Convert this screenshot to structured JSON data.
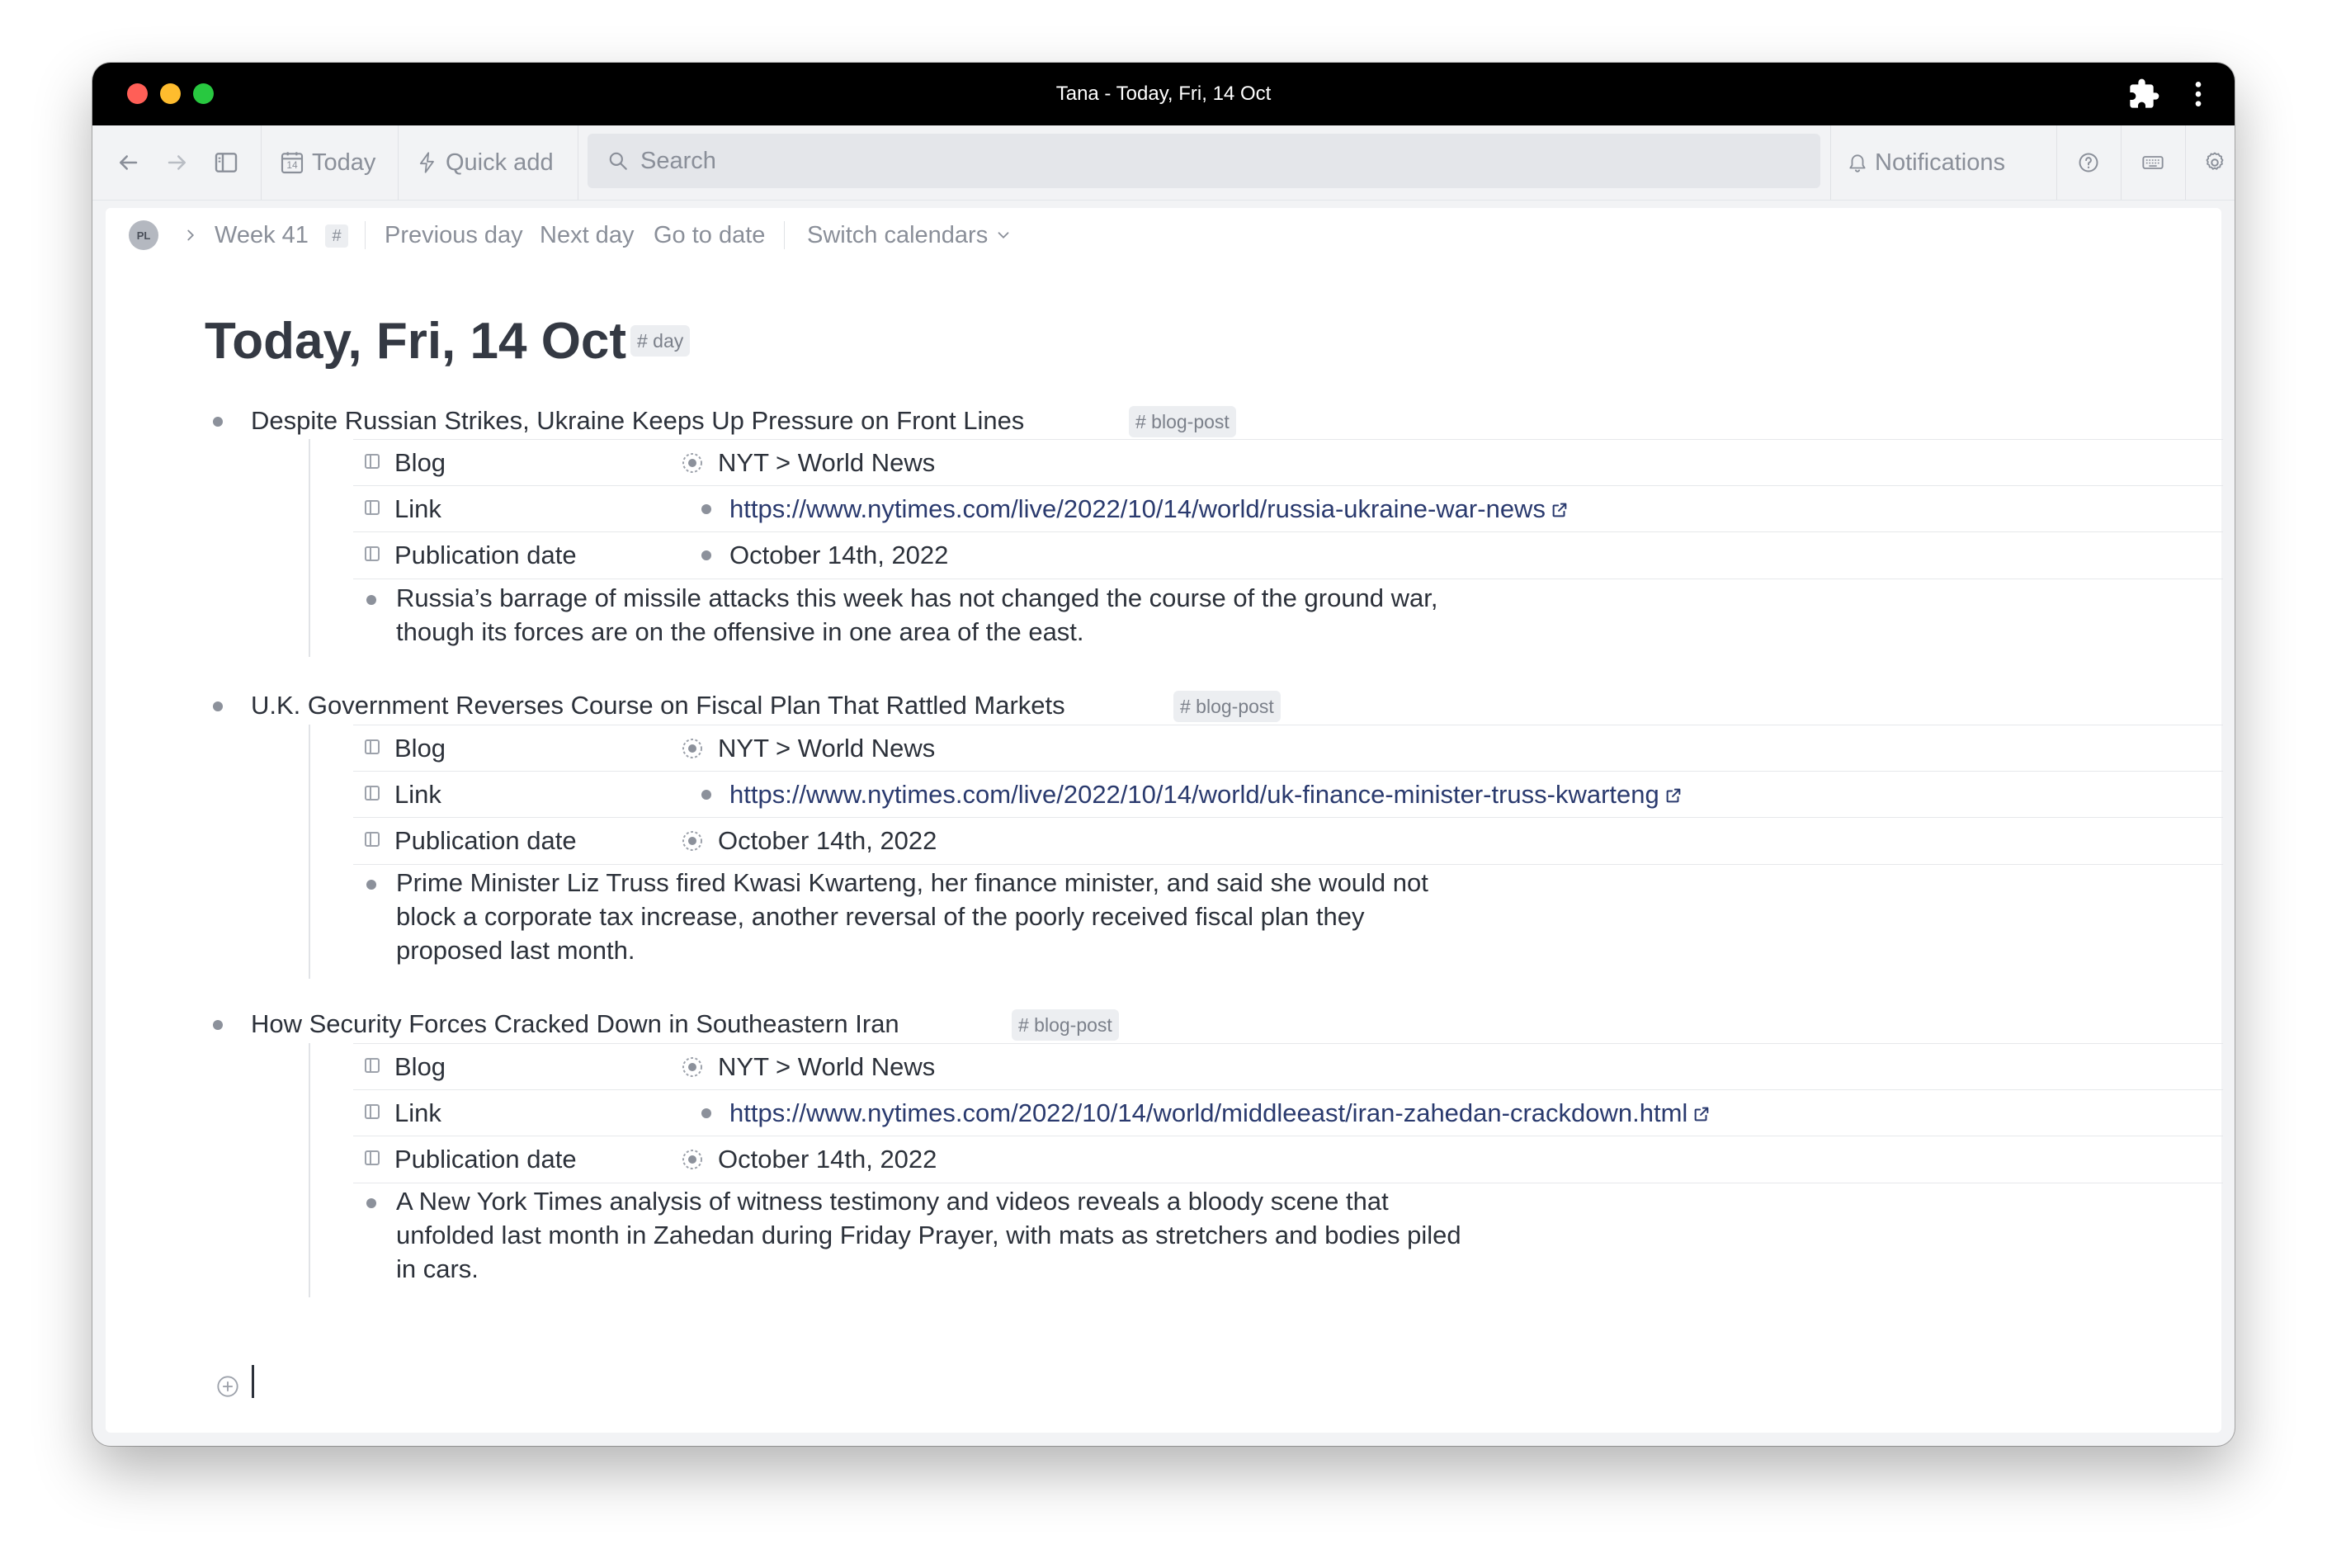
{
  "window": {
    "title": "Tana - Today, Fri, 14 Oct"
  },
  "toolbar": {
    "today_label": "Today",
    "today_icon_day": "14",
    "quick_add_label": "Quick add",
    "search_placeholder": "Search",
    "notifications_label": "Notifications"
  },
  "breadcrumb": {
    "avatar_initials": "PL",
    "week_label": "Week 41",
    "hash": "#",
    "previous_day": "Previous day",
    "next_day": "Next day",
    "go_to_date": "Go to date",
    "switch_calendars": "Switch calendars"
  },
  "page": {
    "title": "Today, Fri, 14 Oct",
    "tag": "# day"
  },
  "posts": [
    {
      "title": "Despite Russian Strikes, Ukraine Keeps Up Pressure on Front Lines",
      "tag": "# blog-post",
      "fields": [
        {
          "label": "Blog",
          "value": "NYT > World News",
          "kind": "reference"
        },
        {
          "label": "Link",
          "value": "https://www.nytimes.com/live/2022/10/14/world/russia-ukraine-war-news",
          "kind": "link"
        },
        {
          "label": "Publication date",
          "value": "October 14th, 2022",
          "kind": "plain"
        }
      ],
      "description_lines": [
        "Russia’s barrage of missile attacks this week has not changed the course of the ground war,",
        "though its forces are on the offensive in one area of the east."
      ]
    },
    {
      "title": "U.K. Government Reverses Course on Fiscal Plan That Rattled Markets",
      "tag": "# blog-post",
      "fields": [
        {
          "label": "Blog",
          "value": "NYT > World News",
          "kind": "reference"
        },
        {
          "label": "Link",
          "value": "https://www.nytimes.com/live/2022/10/14/world/uk-finance-minister-truss-kwarteng",
          "kind": "link"
        },
        {
          "label": "Publication date",
          "value": "October 14th, 2022",
          "kind": "reference"
        }
      ],
      "description_lines": [
        "Prime Minister Liz Truss fired Kwasi Kwarteng, her finance minister, and said she would not",
        "block a corporate tax increase, another reversal of the poorly received fiscal plan they",
        "proposed last month."
      ]
    },
    {
      "title": "How Security Forces Cracked Down in Southeastern Iran",
      "tag": "# blog-post",
      "fields": [
        {
          "label": "Blog",
          "value": "NYT > World News",
          "kind": "reference"
        },
        {
          "label": "Link",
          "value": "https://www.nytimes.com/2022/10/14/world/middleeast/iran-zahedan-crackdown.html",
          "kind": "link"
        },
        {
          "label": "Publication date",
          "value": "October 14th, 2022",
          "kind": "reference"
        }
      ],
      "description_lines": [
        "A New York Times analysis of witness testimony and videos reveals a bloody scene that",
        "unfolded last month in Zahedan during Friday Prayer, with mats as stretchers and bodies piled",
        "in cars."
      ]
    }
  ],
  "icons": {
    "back": "arrow-left-icon",
    "forward": "arrow-right-icon",
    "sidebar": "sidebar-toggle-icon",
    "calendar": "calendar-icon",
    "bolt": "lightning-icon",
    "search": "search-icon",
    "bell": "bell-icon",
    "help": "help-icon",
    "keyboard": "keyboard-icon",
    "settings": "gear-icon",
    "extensions": "puzzle-icon",
    "more": "more-vertical-icon"
  },
  "colors": {
    "titlebar": "#000000",
    "toolbar_bg": "#f2f3f5",
    "link": "#2a3a6e",
    "text": "#2c313a",
    "muted": "#8a8f99"
  }
}
